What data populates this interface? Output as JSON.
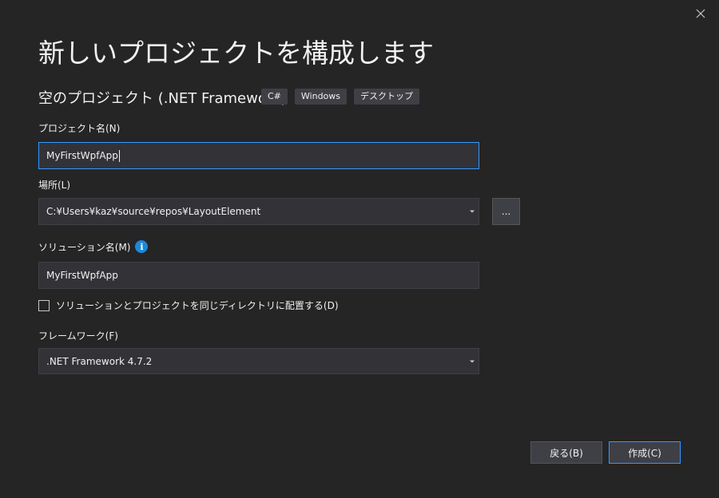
{
  "dialog": {
    "title": "新しいプロジェクトを構成します",
    "template_name": "空のプロジェクト (.NET Framework)",
    "tags": [
      "C#",
      "Windows",
      "デスクトップ"
    ],
    "close_icon": "close-icon"
  },
  "project_name": {
    "label": "プロジェクト名(N)",
    "value": "MyFirstWpfApp"
  },
  "location": {
    "label": "場所(L)",
    "value": "C:¥Users¥kaz¥source¥repos¥LayoutElement",
    "browse_label": "..."
  },
  "solution_name": {
    "label": "ソリューション名(M)",
    "value": "MyFirstWpfApp",
    "info_icon": "info-icon"
  },
  "same_directory": {
    "label": "ソリューションとプロジェクトを同じディレクトリに配置する(D)",
    "checked": false
  },
  "framework": {
    "label": "フレームワーク(F)",
    "value": ".NET Framework 4.7.2"
  },
  "buttons": {
    "back": "戻る(B)",
    "create": "作成(C)"
  },
  "colors": {
    "background": "#252526",
    "field": "#333337",
    "focus_border": "#3399ff",
    "info_blue": "#1e88d8"
  }
}
